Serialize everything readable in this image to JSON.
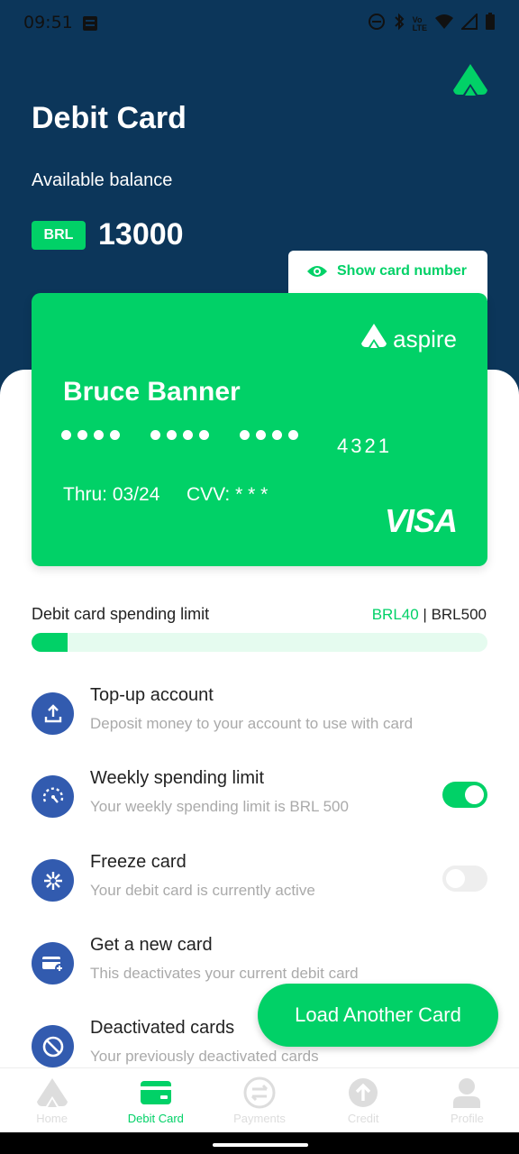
{
  "status_bar": {
    "time": "09:51"
  },
  "header": {
    "title": "Debit Card",
    "balance_label": "Available balance",
    "currency": "BRL",
    "balance": "13000"
  },
  "show_card_number_label": "Show card number",
  "card": {
    "brand": "aspire",
    "holder_name": "Bruce Banner",
    "last4": "4321",
    "thru": "Thru: 03/24",
    "cvv": "CVV: * * *",
    "network": "VISA"
  },
  "spending_limit": {
    "label": "Debit card spending limit",
    "spent": "BRL40",
    "separator": " | ",
    "limit": "BRL500",
    "progress_fraction": 0.08
  },
  "menu": [
    {
      "title": "Top-up account",
      "subtitle": "Deposit money to your account to use with card",
      "icon": "upload-icon"
    },
    {
      "title": "Weekly spending limit",
      "subtitle": "Your weekly spending limit is BRL 500",
      "icon": "speedometer-icon",
      "toggle": true
    },
    {
      "title": "Freeze card",
      "subtitle": "Your debit card is currently active",
      "icon": "snowflake-icon",
      "toggle": false
    },
    {
      "title": "Get a new card",
      "subtitle": "This deactivates your current debit card",
      "icon": "new-card-icon"
    },
    {
      "title": "Deactivated cards",
      "subtitle": "Your previously deactivated cards",
      "icon": "block-icon"
    }
  ],
  "fab_label": "Load Another Card",
  "nav": [
    {
      "label": "Home",
      "icon": "home-logo-icon",
      "active": false
    },
    {
      "label": "Debit Card",
      "icon": "card-icon",
      "active": true
    },
    {
      "label": "Payments",
      "icon": "payments-icon",
      "active": false
    },
    {
      "label": "Credit",
      "icon": "credit-icon",
      "active": false
    },
    {
      "label": "Profile",
      "icon": "profile-icon",
      "active": false
    }
  ],
  "colors": {
    "brand_green": "#01d167",
    "header_navy": "#0c365a",
    "icon_blue": "#325baf"
  }
}
